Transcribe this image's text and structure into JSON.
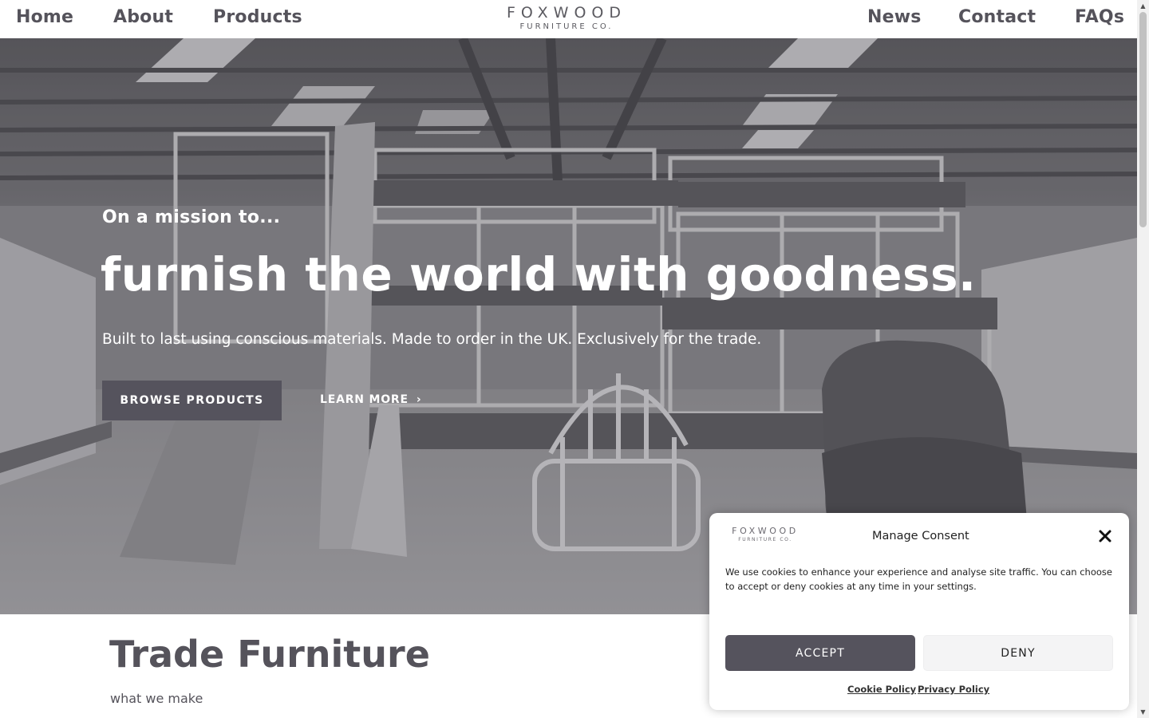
{
  "nav": {
    "left": [
      {
        "label": "Home"
      },
      {
        "label": "About"
      },
      {
        "label": "Products"
      }
    ],
    "right": [
      {
        "label": "News"
      },
      {
        "label": "Contact"
      },
      {
        "label": "FAQs"
      }
    ]
  },
  "brand": {
    "name": "FOXWOOD",
    "tagline": "FURNITURE CO."
  },
  "hero": {
    "kicker": "On a mission to...",
    "headline": "furnish the world with goodness.",
    "subtext": "Built to last using conscious materials. Made to order in the UK. Exclusively for the trade.",
    "primary_button": "BROWSE PRODUCTS",
    "secondary_link": "LEARN MORE",
    "secondary_icon": "chevron-right-icon"
  },
  "section": {
    "title": "Trade Furniture",
    "subtitle": "what we make"
  },
  "consent": {
    "title": "Manage Consent",
    "close_icon": "close-icon",
    "body": "We use cookies to enhance your experience and analyse site traffic. You can choose to accept or deny cookies at any time in your settings.",
    "accept_label": "ACCEPT",
    "deny_label": "DENY",
    "cookie_policy_label": "Cookie Policy",
    "privacy_policy_label": "Privacy Policy"
  },
  "colors": {
    "brand_dark": "#55535d",
    "text": "#55535b",
    "deny_bg": "#f4f4f5"
  }
}
